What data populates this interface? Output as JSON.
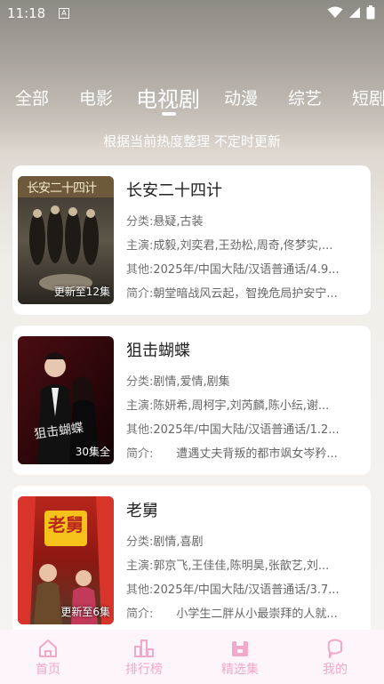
{
  "status": {
    "time": "11:18",
    "notif_glyph": "A"
  },
  "tabs": [
    "全部",
    "电影",
    "电视剧",
    "动漫",
    "综艺",
    "短剧"
  ],
  "active_tab": "电视剧",
  "subtitle": "根据当前热度整理 不定时更新",
  "labels": {
    "genre": "分类:",
    "cast": "主演:",
    "other": "其他:",
    "intro": "简介:"
  },
  "items": [
    {
      "title": "长安二十四计",
      "genre": "悬疑,古装",
      "cast": "成毅,刘奕君,王劲松,周奇,佟梦实,...",
      "other": "2025年/中国大陆/汉语普通话/4.9...",
      "intro": "朝堂暗战风云起，智挽危局护安宁...",
      "badge": "更新至12集",
      "poster_title": "长安二十四计"
    },
    {
      "title": "狙击蝴蝶",
      "genre": "剧情,爱情,剧集",
      "cast": "陈妍希,周柯宇,刘芮麟,陈小纭,谢...",
      "other": "2025年/中国大陆/汉语普通话/1.2...",
      "intro": "　　遭遇丈夫背叛的都市飒女岑矜...",
      "badge": "30集全",
      "poster_title": "狙击蝴蝶"
    },
    {
      "title": "老舅",
      "genre": "剧情,喜剧",
      "cast": "郭京飞,王佳佳,陈明昊,张歆艺,刘...",
      "other": "2025年/中国大陆/汉语普通话/3.7...",
      "intro": "　　小学生二胖从小最崇拜的人就...",
      "badge": "更新至6集",
      "poster_title": "老舅"
    }
  ],
  "nav": [
    {
      "label": "首页",
      "icon": "home-icon"
    },
    {
      "label": "排行榜",
      "icon": "ranking-icon"
    },
    {
      "label": "精选集",
      "icon": "collection-icon"
    },
    {
      "label": "我的",
      "icon": "profile-icon"
    }
  ]
}
